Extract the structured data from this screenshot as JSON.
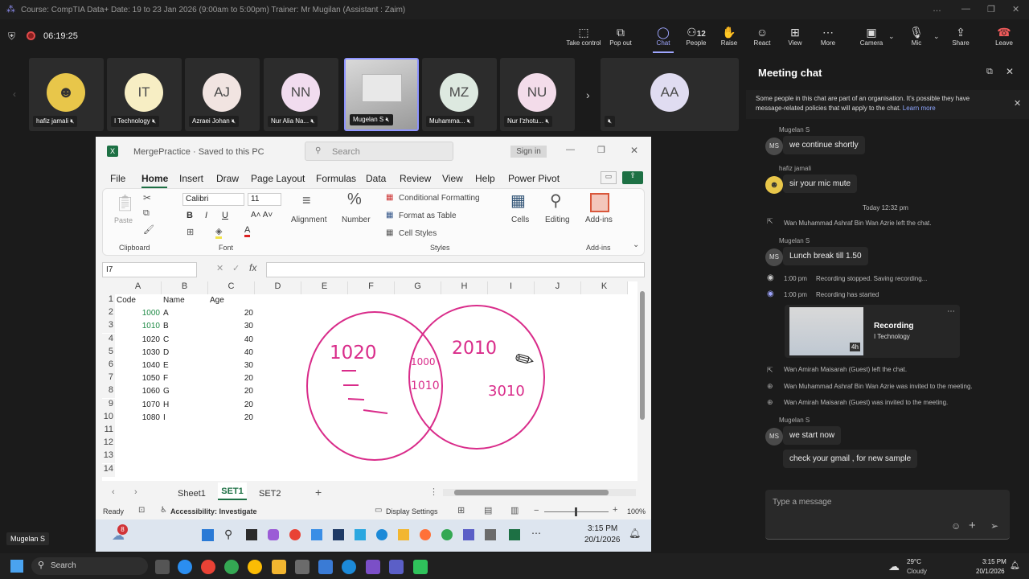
{
  "window": {
    "title": "Course: CompTIA Data+ Date: 19 to 23 Jan 2026 (9:00am to 5:00pm) Trainer: Mr Mugilan (Assistant : Zaim)",
    "timer": "06:19:25"
  },
  "toolbar": {
    "items": [
      {
        "label": "Take control",
        "icon": "take-control-icon"
      },
      {
        "label": "Pop out",
        "icon": "pop-out-icon"
      },
      {
        "label": "Chat",
        "icon": "chat-icon"
      },
      {
        "label": "People",
        "icon": "people-icon",
        "count": "12"
      },
      {
        "label": "Raise",
        "icon": "raise-hand-icon"
      },
      {
        "label": "React",
        "icon": "react-icon"
      },
      {
        "label": "View",
        "icon": "view-icon"
      },
      {
        "label": "More",
        "icon": "more-icon"
      },
      {
        "label": "Camera",
        "icon": "camera-off-icon"
      },
      {
        "label": "Mic",
        "icon": "mic-off-icon"
      },
      {
        "label": "Share",
        "icon": "share-icon"
      },
      {
        "label": "Leave",
        "icon": "leave-icon"
      }
    ]
  },
  "participants": [
    {
      "name": "hafiz jamali",
      "initials": "",
      "color": "#e8c64a"
    },
    {
      "name": "I Technology",
      "initials": "IT",
      "color": "#f7eec4"
    },
    {
      "name": "Azraei Johan",
      "initials": "AJ",
      "color": "#f1e4e1"
    },
    {
      "name": "Nur Alia Na...",
      "initials": "NN",
      "color": "#f1dcef"
    },
    {
      "name": "Mugelan S",
      "initials": "",
      "color": "#bdbdbd"
    },
    {
      "name": "Muhamma...",
      "initials": "MZ",
      "color": "#dde9e0"
    },
    {
      "name": "Nur I'zhotu...",
      "initials": "NU",
      "color": "#f3dcea"
    },
    {
      "name": "",
      "initials": "AA",
      "color": "#e0dcf1"
    }
  ],
  "excel": {
    "file": "MergePractice · Saved to this PC",
    "search_placeholder": "Search",
    "signin": "Sign in",
    "menu": [
      "File",
      "Home",
      "Insert",
      "Draw",
      "Page Layout",
      "Formulas",
      "Data",
      "Review",
      "View",
      "Help",
      "Power Pivot"
    ],
    "ribbon": {
      "paste": "Paste",
      "clipboard": "Clipboard",
      "font_name": "Calibri",
      "font_size": "11",
      "font": "Font",
      "alignment": "Alignment",
      "number": "Number",
      "cond_format": "Conditional Formatting",
      "format_table": "Format as Table",
      "cell_styles": "Cell Styles",
      "styles": "Styles",
      "cells": "Cells",
      "editing": "Editing",
      "addins": "Add-ins",
      "addins_group": "Add-ins"
    },
    "name_box": "I7",
    "columns": [
      "A",
      "B",
      "C",
      "D",
      "E",
      "F",
      "G",
      "H",
      "I",
      "J",
      "K"
    ],
    "rows": [
      [
        "Code",
        "Name",
        "Age"
      ],
      [
        "1000",
        "A",
        "20"
      ],
      [
        "1010",
        "B",
        "30"
      ],
      [
        "1020",
        "C",
        "40"
      ],
      [
        "1030",
        "D",
        "40"
      ],
      [
        "1040",
        "E",
        "30"
      ],
      [
        "1050",
        "F",
        "20"
      ],
      [
        "1060",
        "G",
        "20"
      ],
      [
        "1070",
        "H",
        "20"
      ],
      [
        "1080",
        "I",
        "20"
      ],
      [
        "",
        "",
        ""
      ],
      [
        "",
        "",
        ""
      ],
      [
        "",
        "",
        ""
      ],
      [
        "",
        "",
        ""
      ]
    ],
    "ink": {
      "left": "1020",
      "overlap_top": "1000",
      "overlap_bottom": "1010",
      "right_top": "2010",
      "right_bottom": "3010"
    },
    "sheets": [
      "Sheet1",
      "SET1",
      "SET2"
    ],
    "status": {
      "ready": "Ready",
      "accessibility": "Accessibility: Investigate",
      "display": "Display Settings",
      "zoom": "100%"
    },
    "taskbar": {
      "time": "3:15 PM",
      "date": "20/1/2026",
      "badge": "8"
    }
  },
  "presenter_label": "Mugelan S",
  "chat": {
    "title": "Meeting chat",
    "notice": "Some people in this chat are part of an organisation. It's possible they have message-related policies that will apply to the chat.",
    "learn_more": "Learn more",
    "messages": {
      "m1_sender": "Mugelan S",
      "m1_text": "we continue shortly",
      "m2_sender": "hafiz jamali",
      "m2_text": "sir your mic mute",
      "date_sep": "Today 12:32 pm",
      "sys1": "Wan Muhammad Ashraf Bin Wan Azrie left the chat.",
      "m3_sender": "Mugelan S",
      "m3_text": "Lunch break till 1.50",
      "sys2_time": "1:00 pm",
      "sys2": "Recording stopped. Saving recording...",
      "sys3_time": "1:00 pm",
      "sys3": "Recording has started",
      "rec_title": "Recording",
      "rec_sub": "I Technology",
      "rec_dur": "4h",
      "sys4": "Wan Amirah Maisarah (Guest) left the chat.",
      "sys5": "Wan Muhammad Ashraf Bin Wan Azrie was invited to the meeting.",
      "sys6": "Wan Amirah Maisarah (Guest) was invited to the meeting.",
      "m4_sender": "Mugelan S",
      "m4_text": "we start now",
      "m5_text": "check your gmail , for new sample",
      "ms_initials": "MS"
    },
    "input_placeholder": "Type a message"
  },
  "taskbar": {
    "search": "Search",
    "weather_temp": "29°C",
    "weather_desc": "Cloudy",
    "time": "3:15 PM",
    "date": "20/1/2026"
  }
}
